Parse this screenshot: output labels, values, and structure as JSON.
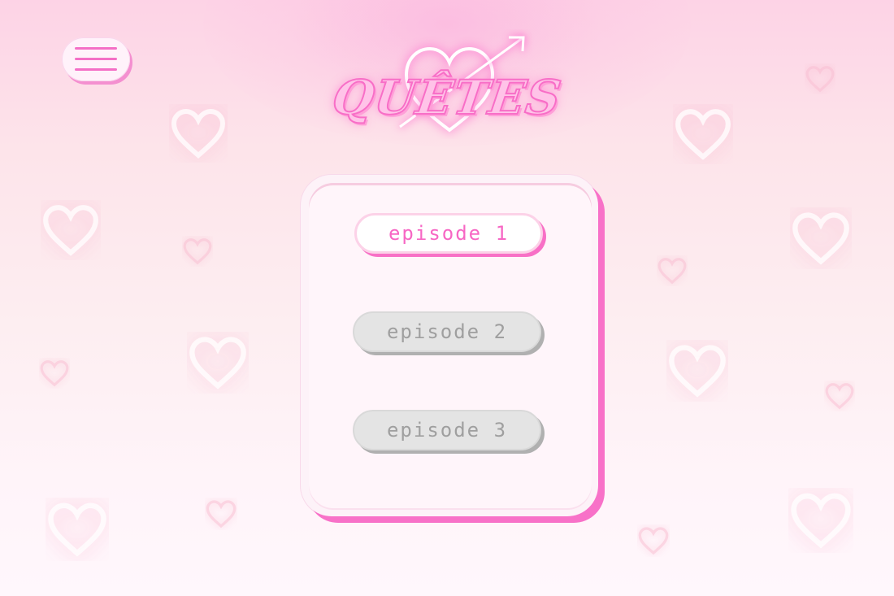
{
  "header": {
    "menu_icon": "hamburger-menu-icon",
    "logo_text": "QUÊTES",
    "logo_icon": "heart-arrow-icon"
  },
  "episodes": [
    {
      "label": "episode 1",
      "state": "unlocked"
    },
    {
      "label": "episode 2",
      "state": "locked"
    },
    {
      "label": "episode 3",
      "state": "locked"
    }
  ],
  "colors": {
    "accent": "#f767c4",
    "accent_shadow": "#f870c6",
    "locked_bg": "#e4e4e4",
    "locked_text": "#9f9f9f",
    "card_bg": "#fff5fa"
  },
  "decor": {
    "background_icon": "heart-outline-icon"
  }
}
